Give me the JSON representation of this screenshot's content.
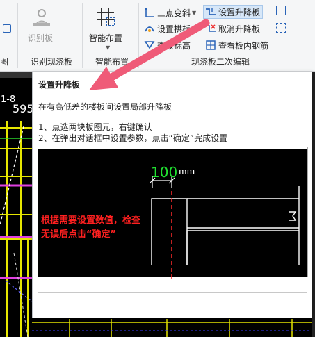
{
  "ribbon": {
    "left_group_label": "图",
    "identify_board_label": "识别板",
    "identify_group_label": "识别现浇板",
    "smart_layout_label": "智能布置",
    "smart_group_label": "智能布置",
    "edit_group_label": "现浇板二次编辑",
    "buttons": {
      "three_point_slope": "三点变斜",
      "set_step_board": "设置升降板",
      "set_arch": "设置拱板",
      "cancel_step_board": "取消升降板",
      "elevation": "查改标高",
      "view_rebar": "查看板内钢筋"
    },
    "accent_color": "#2a64b8"
  },
  "canvas": {
    "label_fragment_1": "1-8",
    "label_fragment_2": "595"
  },
  "tooltip": {
    "title": "设置升降板",
    "description": "在有高低差的楼板间设置局部升降板",
    "steps": [
      "1、点选两块板图元，右键确认",
      "2、在弹出对话框中设置参数，点击“确定”完成设置"
    ],
    "image": {
      "dimension_value": "100",
      "dimension_unit": "mm",
      "annotation": "根据需要设置数值，检查无误后点击“确定”"
    }
  },
  "callout_arrow_color": "#ef5b78"
}
